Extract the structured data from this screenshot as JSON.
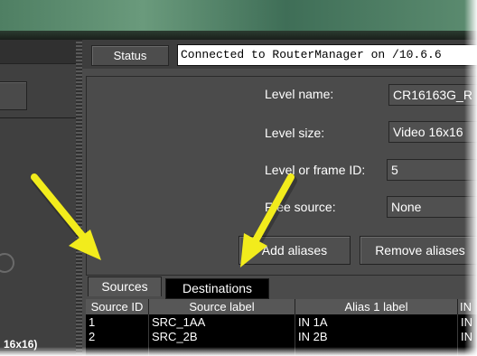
{
  "status": {
    "button_label": "Status",
    "message": "Connected to RouterManager on /10.6.6"
  },
  "form": {
    "level_name_label": "Level name:",
    "level_name_value": "CR16163G_R",
    "level_size_label": "Level size:",
    "level_size_value": "Video 16x16",
    "level_id_label": "Level or frame ID:",
    "level_id_value": "5",
    "free_source_label": "Free source:",
    "free_source_value": "None"
  },
  "actions": {
    "add_aliases": "Add aliases",
    "remove_aliases": "Remove aliases"
  },
  "tabs": {
    "sources": "Sources",
    "destinations": "Destinations"
  },
  "table": {
    "headers": [
      "Source ID",
      "Source label",
      "Alias 1 label",
      "IN"
    ],
    "rows": [
      [
        "1",
        "SRC_1AA",
        "IN 1A",
        "IN"
      ],
      [
        "2",
        "SRC_2B",
        "IN 2B",
        "IN"
      ]
    ]
  },
  "left_panel": {
    "label": "16x16)"
  },
  "colors": {
    "arrow": "#f2ec1c",
    "panel": "#4b4b4b",
    "banner": "#5c8c70"
  }
}
